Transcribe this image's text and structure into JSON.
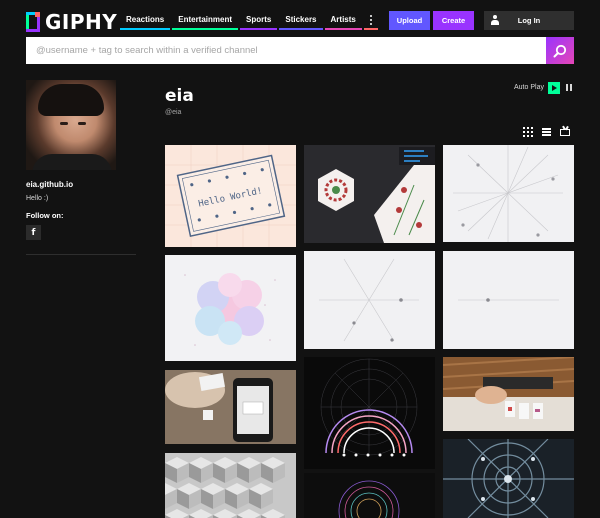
{
  "header": {
    "logo_text": "GIPHY",
    "nav": [
      {
        "label": "Reactions",
        "color": "#00ccff"
      },
      {
        "label": "Entertainment",
        "color": "#00ff99"
      },
      {
        "label": "Sports",
        "color": "#9933ff"
      },
      {
        "label": "Stickers",
        "color": "#6157ff"
      },
      {
        "label": "Artists",
        "color": "#e646b6"
      }
    ],
    "more_icon": "vertical-ellipsis-icon",
    "upload_label": "Upload",
    "create_label": "Create",
    "login_label": "Log In"
  },
  "search": {
    "placeholder": "@username + tag to search within a verified channel",
    "value": "",
    "icon": "search-icon"
  },
  "profile": {
    "website": "eia.github.io",
    "bio": "Hello :)",
    "follow_label": "Follow on:",
    "social_icon": "facebook-icon"
  },
  "channel": {
    "name": "eia",
    "handle": "@eia",
    "autoplay_label": "Auto Play",
    "autoplay_on": true,
    "view_modes": [
      "grid-view-icon",
      "list-view-icon",
      "tv-view-icon"
    ]
  },
  "gifs": [
    {
      "id": "gif-hello-world-card",
      "caption": "Hello World!"
    },
    {
      "id": "gif-floral-hexagon"
    },
    {
      "id": "gif-radial-lines"
    },
    {
      "id": "gif-pastel-blobs"
    },
    {
      "id": "gif-three-spokes"
    },
    {
      "id": "gif-single-line"
    },
    {
      "id": "gif-phone-hand"
    },
    {
      "id": "gif-rainbow-arcs"
    },
    {
      "id": "gif-desk-cards"
    },
    {
      "id": "gif-isometric-cubes"
    },
    {
      "id": "gif-spiral-dots"
    },
    {
      "id": "gif-kaleidoscope"
    }
  ],
  "colors": {
    "background": "#121212",
    "upload": "#6157ff",
    "create": "#9933ff",
    "autoplay": "#00ff99"
  }
}
